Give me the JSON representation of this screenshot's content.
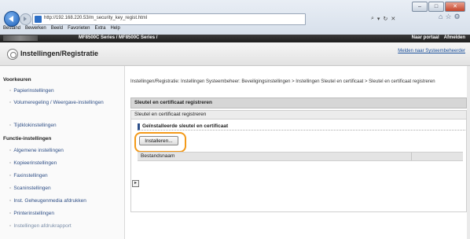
{
  "browser": {
    "url": "http://192.168.220.53/m_security_key_regist.html",
    "menu": [
      "Bestand",
      "Bewerken",
      "Beeld",
      "Favorieten",
      "Extra",
      "Help"
    ],
    "tool_icons": [
      "search-icon",
      "refresh-icon",
      "stop-icon"
    ],
    "window_controls": [
      "minimize",
      "maximize",
      "close"
    ]
  },
  "appbar": {
    "title": "MF8500C Series / MF8500C Series /",
    "links": [
      "Naar portaal",
      "Afmelden"
    ]
  },
  "header": {
    "title": "Instellingen/Registratie",
    "portal_link": "Melden naar Systeembeheerder"
  },
  "sidebar": {
    "section1": "Voorkeuren",
    "prefs": [
      "Papierinstellingen",
      "Volumeregeling / Weergave-instellingen",
      "Tijdklokinstellingen"
    ],
    "section2": "Functie-instellingen",
    "functions": [
      "Algemene instellingen",
      "Kopieerinstellingen",
      "Faxinstellingen",
      "Scaninstellingen",
      "Inst. Geheugenmedia afdrukken",
      "Printerinstellingen",
      "Instellingen afdrukrapport"
    ]
  },
  "main": {
    "breadcrumb": "Instellingen/Registratie: Instellingen Systeembeheer: Beveiligingsinstellingen > Instellingen Sleutel en certificaat > Sleutel en certificaat registreren",
    "section_title": "Sleutel en certificaat registreren",
    "panel_title": "Sleutel en certificaat registreren",
    "subheading": "Geïnstalleerde sleutel en certificaat",
    "install_button": "Installeren...",
    "table_header": "Bestandsnaam"
  }
}
